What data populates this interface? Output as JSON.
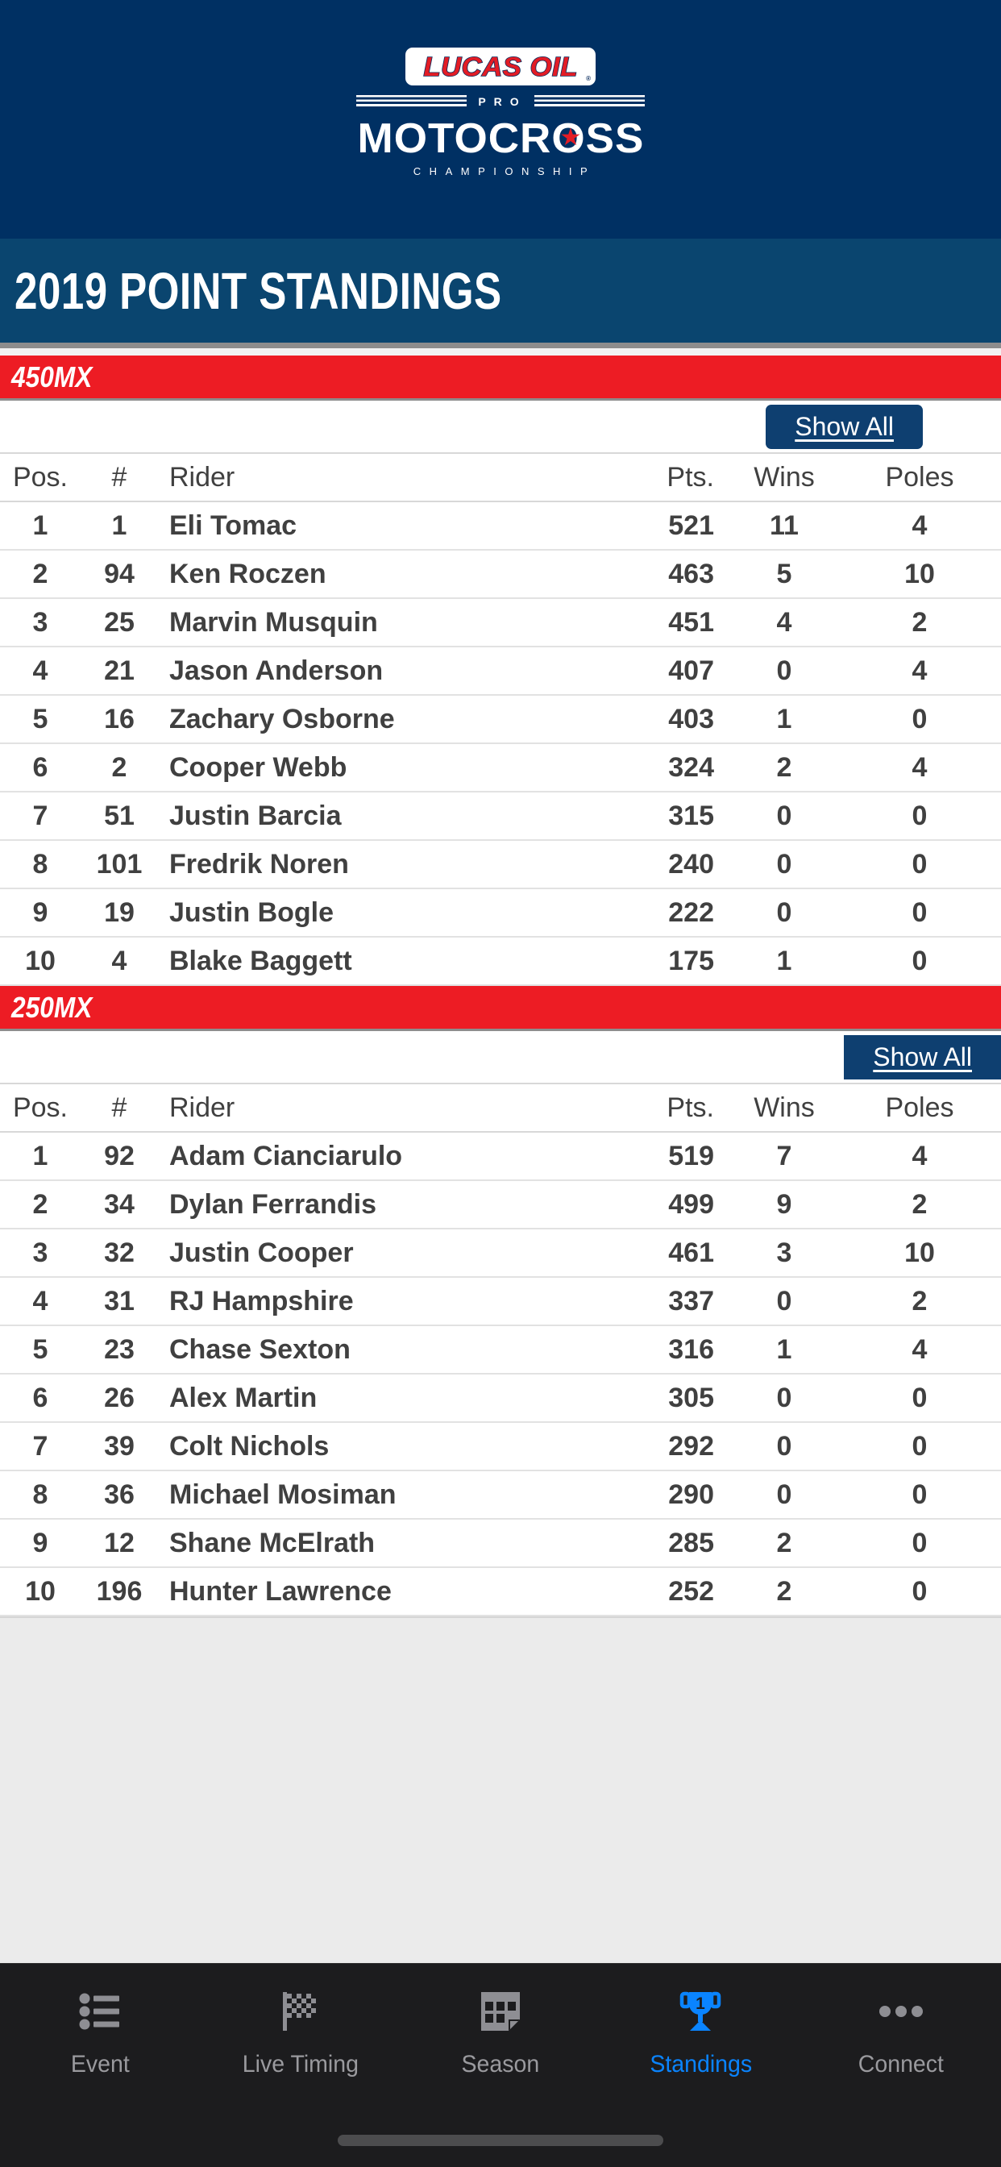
{
  "header": {
    "logo": {
      "brand": "LUCAS OIL",
      "registered": "®",
      "pro": "PRO",
      "motocross": "MOTOCROSS",
      "championship": "CHAMPIONSHIP",
      "star_icon": "star-icon",
      "colors": {
        "navy": "#003063",
        "red": "#e31c25",
        "white": "#ffffff"
      }
    },
    "page_title": "2019 POINT STANDINGS",
    "title_bar_color": "#0a456f"
  },
  "sections": [
    {
      "class_name": "450MX",
      "class_bar_color": "#ed1c24",
      "show_all_label": "Show All",
      "columns": [
        "Pos.",
        "#",
        "Rider",
        "Pts.",
        "Wins",
        "Poles"
      ],
      "rows": [
        {
          "pos": "1",
          "num": "1",
          "rider": "Eli Tomac",
          "pts": "521",
          "wins": "11",
          "poles": "4"
        },
        {
          "pos": "2",
          "num": "94",
          "rider": "Ken Roczen",
          "pts": "463",
          "wins": "5",
          "poles": "10"
        },
        {
          "pos": "3",
          "num": "25",
          "rider": "Marvin Musquin",
          "pts": "451",
          "wins": "4",
          "poles": "2"
        },
        {
          "pos": "4",
          "num": "21",
          "rider": "Jason Anderson",
          "pts": "407",
          "wins": "0",
          "poles": "4"
        },
        {
          "pos": "5",
          "num": "16",
          "rider": "Zachary Osborne",
          "pts": "403",
          "wins": "1",
          "poles": "0"
        },
        {
          "pos": "6",
          "num": "2",
          "rider": "Cooper Webb",
          "pts": "324",
          "wins": "2",
          "poles": "4"
        },
        {
          "pos": "7",
          "num": "51",
          "rider": "Justin Barcia",
          "pts": "315",
          "wins": "0",
          "poles": "0"
        },
        {
          "pos": "8",
          "num": "101",
          "rider": "Fredrik Noren",
          "pts": "240",
          "wins": "0",
          "poles": "0"
        },
        {
          "pos": "9",
          "num": "19",
          "rider": "Justin Bogle",
          "pts": "222",
          "wins": "0",
          "poles": "0"
        },
        {
          "pos": "10",
          "num": "4",
          "rider": "Blake Baggett",
          "pts": "175",
          "wins": "1",
          "poles": "0"
        }
      ]
    },
    {
      "class_name": "250MX",
      "class_bar_color": "#ed1c24",
      "show_all_label": "Show All",
      "columns": [
        "Pos.",
        "#",
        "Rider",
        "Pts.",
        "Wins",
        "Poles"
      ],
      "rows": [
        {
          "pos": "1",
          "num": "92",
          "rider": "Adam Cianciarulo",
          "pts": "519",
          "wins": "7",
          "poles": "4"
        },
        {
          "pos": "2",
          "num": "34",
          "rider": "Dylan Ferrandis",
          "pts": "499",
          "wins": "9",
          "poles": "2"
        },
        {
          "pos": "3",
          "num": "32",
          "rider": "Justin Cooper",
          "pts": "461",
          "wins": "3",
          "poles": "10"
        },
        {
          "pos": "4",
          "num": "31",
          "rider": "RJ Hampshire",
          "pts": "337",
          "wins": "0",
          "poles": "2"
        },
        {
          "pos": "5",
          "num": "23",
          "rider": "Chase Sexton",
          "pts": "316",
          "wins": "1",
          "poles": "4"
        },
        {
          "pos": "6",
          "num": "26",
          "rider": "Alex Martin",
          "pts": "305",
          "wins": "0",
          "poles": "0"
        },
        {
          "pos": "7",
          "num": "39",
          "rider": "Colt Nichols",
          "pts": "292",
          "wins": "0",
          "poles": "0"
        },
        {
          "pos": "8",
          "num": "36",
          "rider": "Michael Mosiman",
          "pts": "290",
          "wins": "0",
          "poles": "0"
        },
        {
          "pos": "9",
          "num": "12",
          "rider": "Shane McElrath",
          "pts": "285",
          "wins": "2",
          "poles": "0"
        },
        {
          "pos": "10",
          "num": "196",
          "rider": "Hunter Lawrence",
          "pts": "252",
          "wins": "2",
          "poles": "0"
        }
      ]
    }
  ],
  "tabbar": {
    "active_color": "#0a84ff",
    "inactive_color": "#9a9a9e",
    "items": [
      {
        "label": "Event",
        "icon": "list-icon",
        "active": false
      },
      {
        "label": "Live Timing",
        "icon": "checkered-flag-icon",
        "active": false
      },
      {
        "label": "Season",
        "icon": "calendar-grid-icon",
        "active": false
      },
      {
        "label": "Standings",
        "icon": "trophy-icon",
        "active": true
      },
      {
        "label": "Connect",
        "icon": "ellipsis-icon",
        "active": false
      }
    ]
  }
}
